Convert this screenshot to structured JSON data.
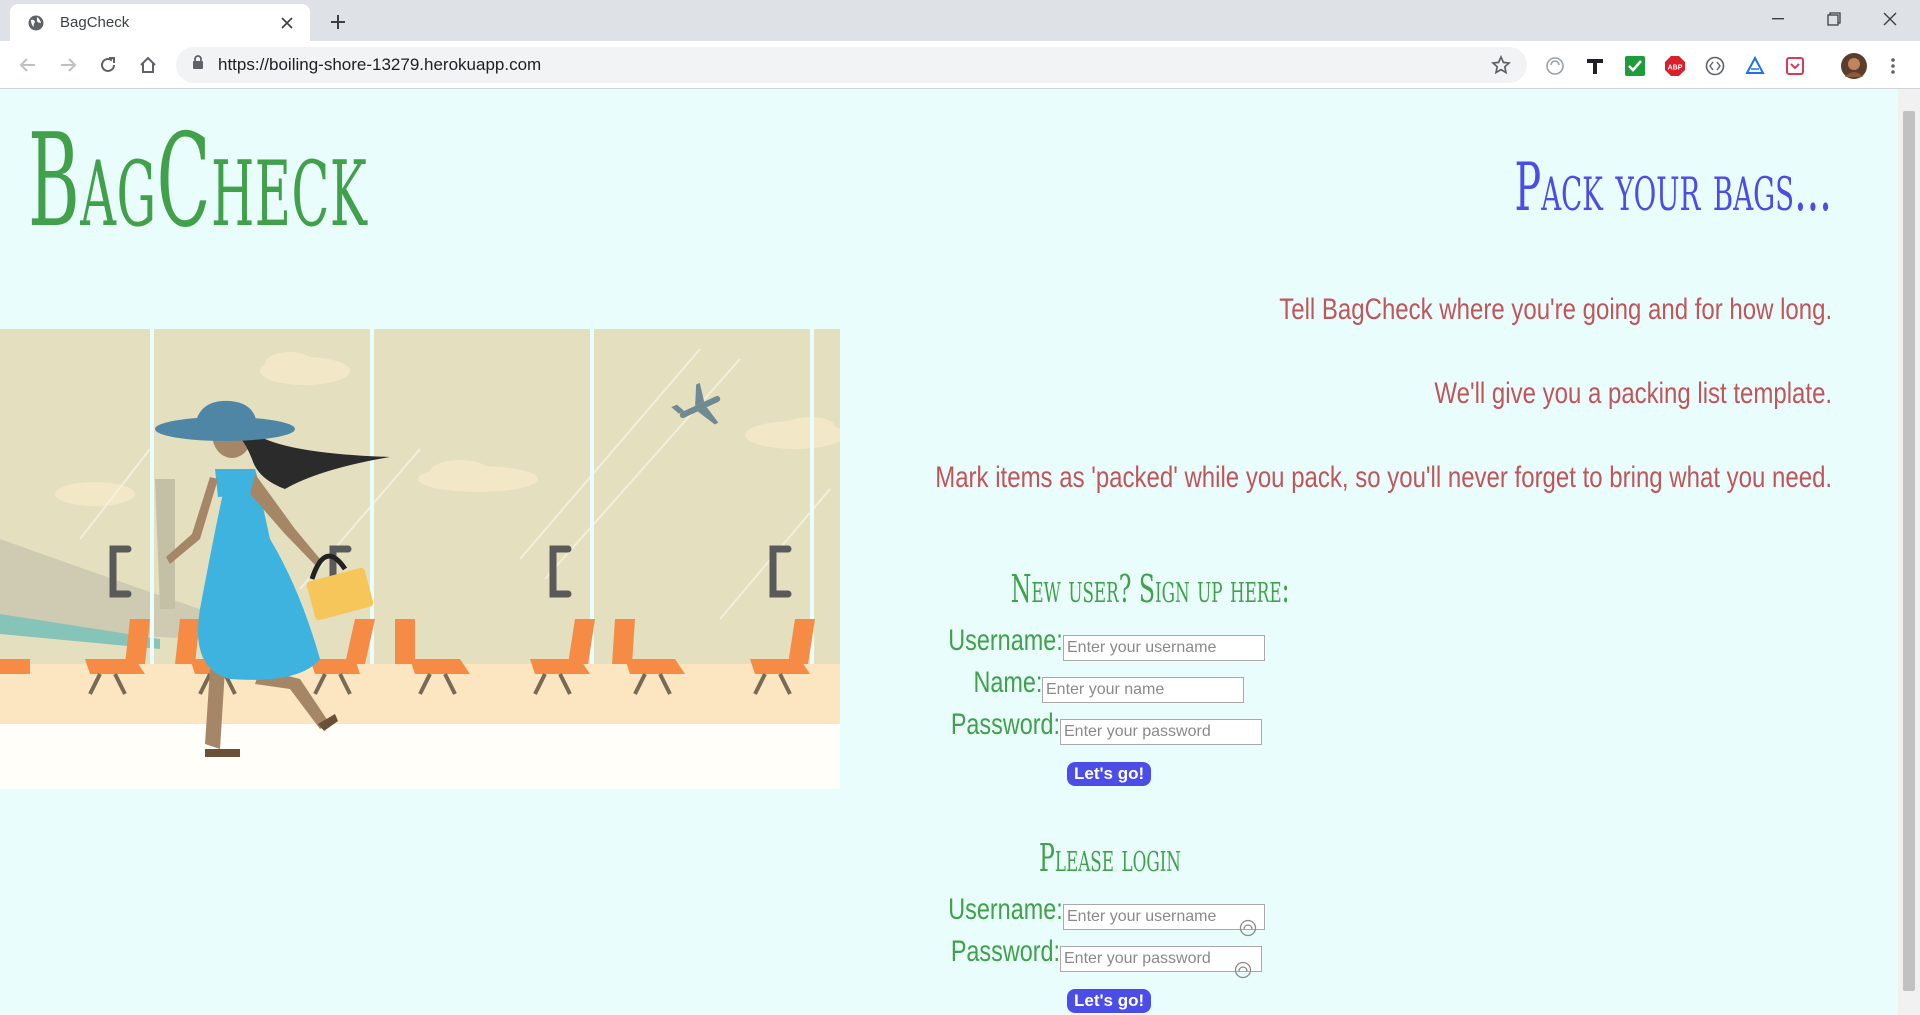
{
  "browser": {
    "tab_title": "BagCheck",
    "new_tab_label": "+",
    "url": "https://boiling-shore-13279.herokuapp.com"
  },
  "colors": {
    "brand_green": "#41a04a",
    "accent_blue": "#4b4de6",
    "desc_red": "#c0555a",
    "page_bg": "#e9fdfd"
  },
  "header": {
    "brand": "BagCheck",
    "tagline": "Pack your bags..."
  },
  "intro": {
    "lines": [
      "Tell BagCheck where you're going and for how long.",
      "We'll give you a packing list template.",
      "Mark items as 'packed' while you pack, so you'll never forget to bring what you need."
    ]
  },
  "signup": {
    "title": "New user? Sign up here:",
    "username_label": "Username:",
    "username_placeholder": "Enter your username",
    "name_label": "Name:",
    "name_placeholder": "Enter your name",
    "password_label": "Password:",
    "password_placeholder": "Enter your password",
    "submit_label": "Let's go!"
  },
  "login": {
    "title": "Please login",
    "username_label": "Username:",
    "username_placeholder": "Enter your username",
    "password_label": "Password:",
    "password_placeholder": "Enter your password",
    "submit_label": "Let's go!"
  },
  "icons": {
    "favicon": "globe-icon",
    "extensions": [
      "pocket-icon",
      "t-icon",
      "checkmark-icon",
      "adblock-icon",
      "code-icon",
      "drive-icon",
      "save-icon",
      "profile-avatar",
      "menu-dots-icon"
    ]
  }
}
